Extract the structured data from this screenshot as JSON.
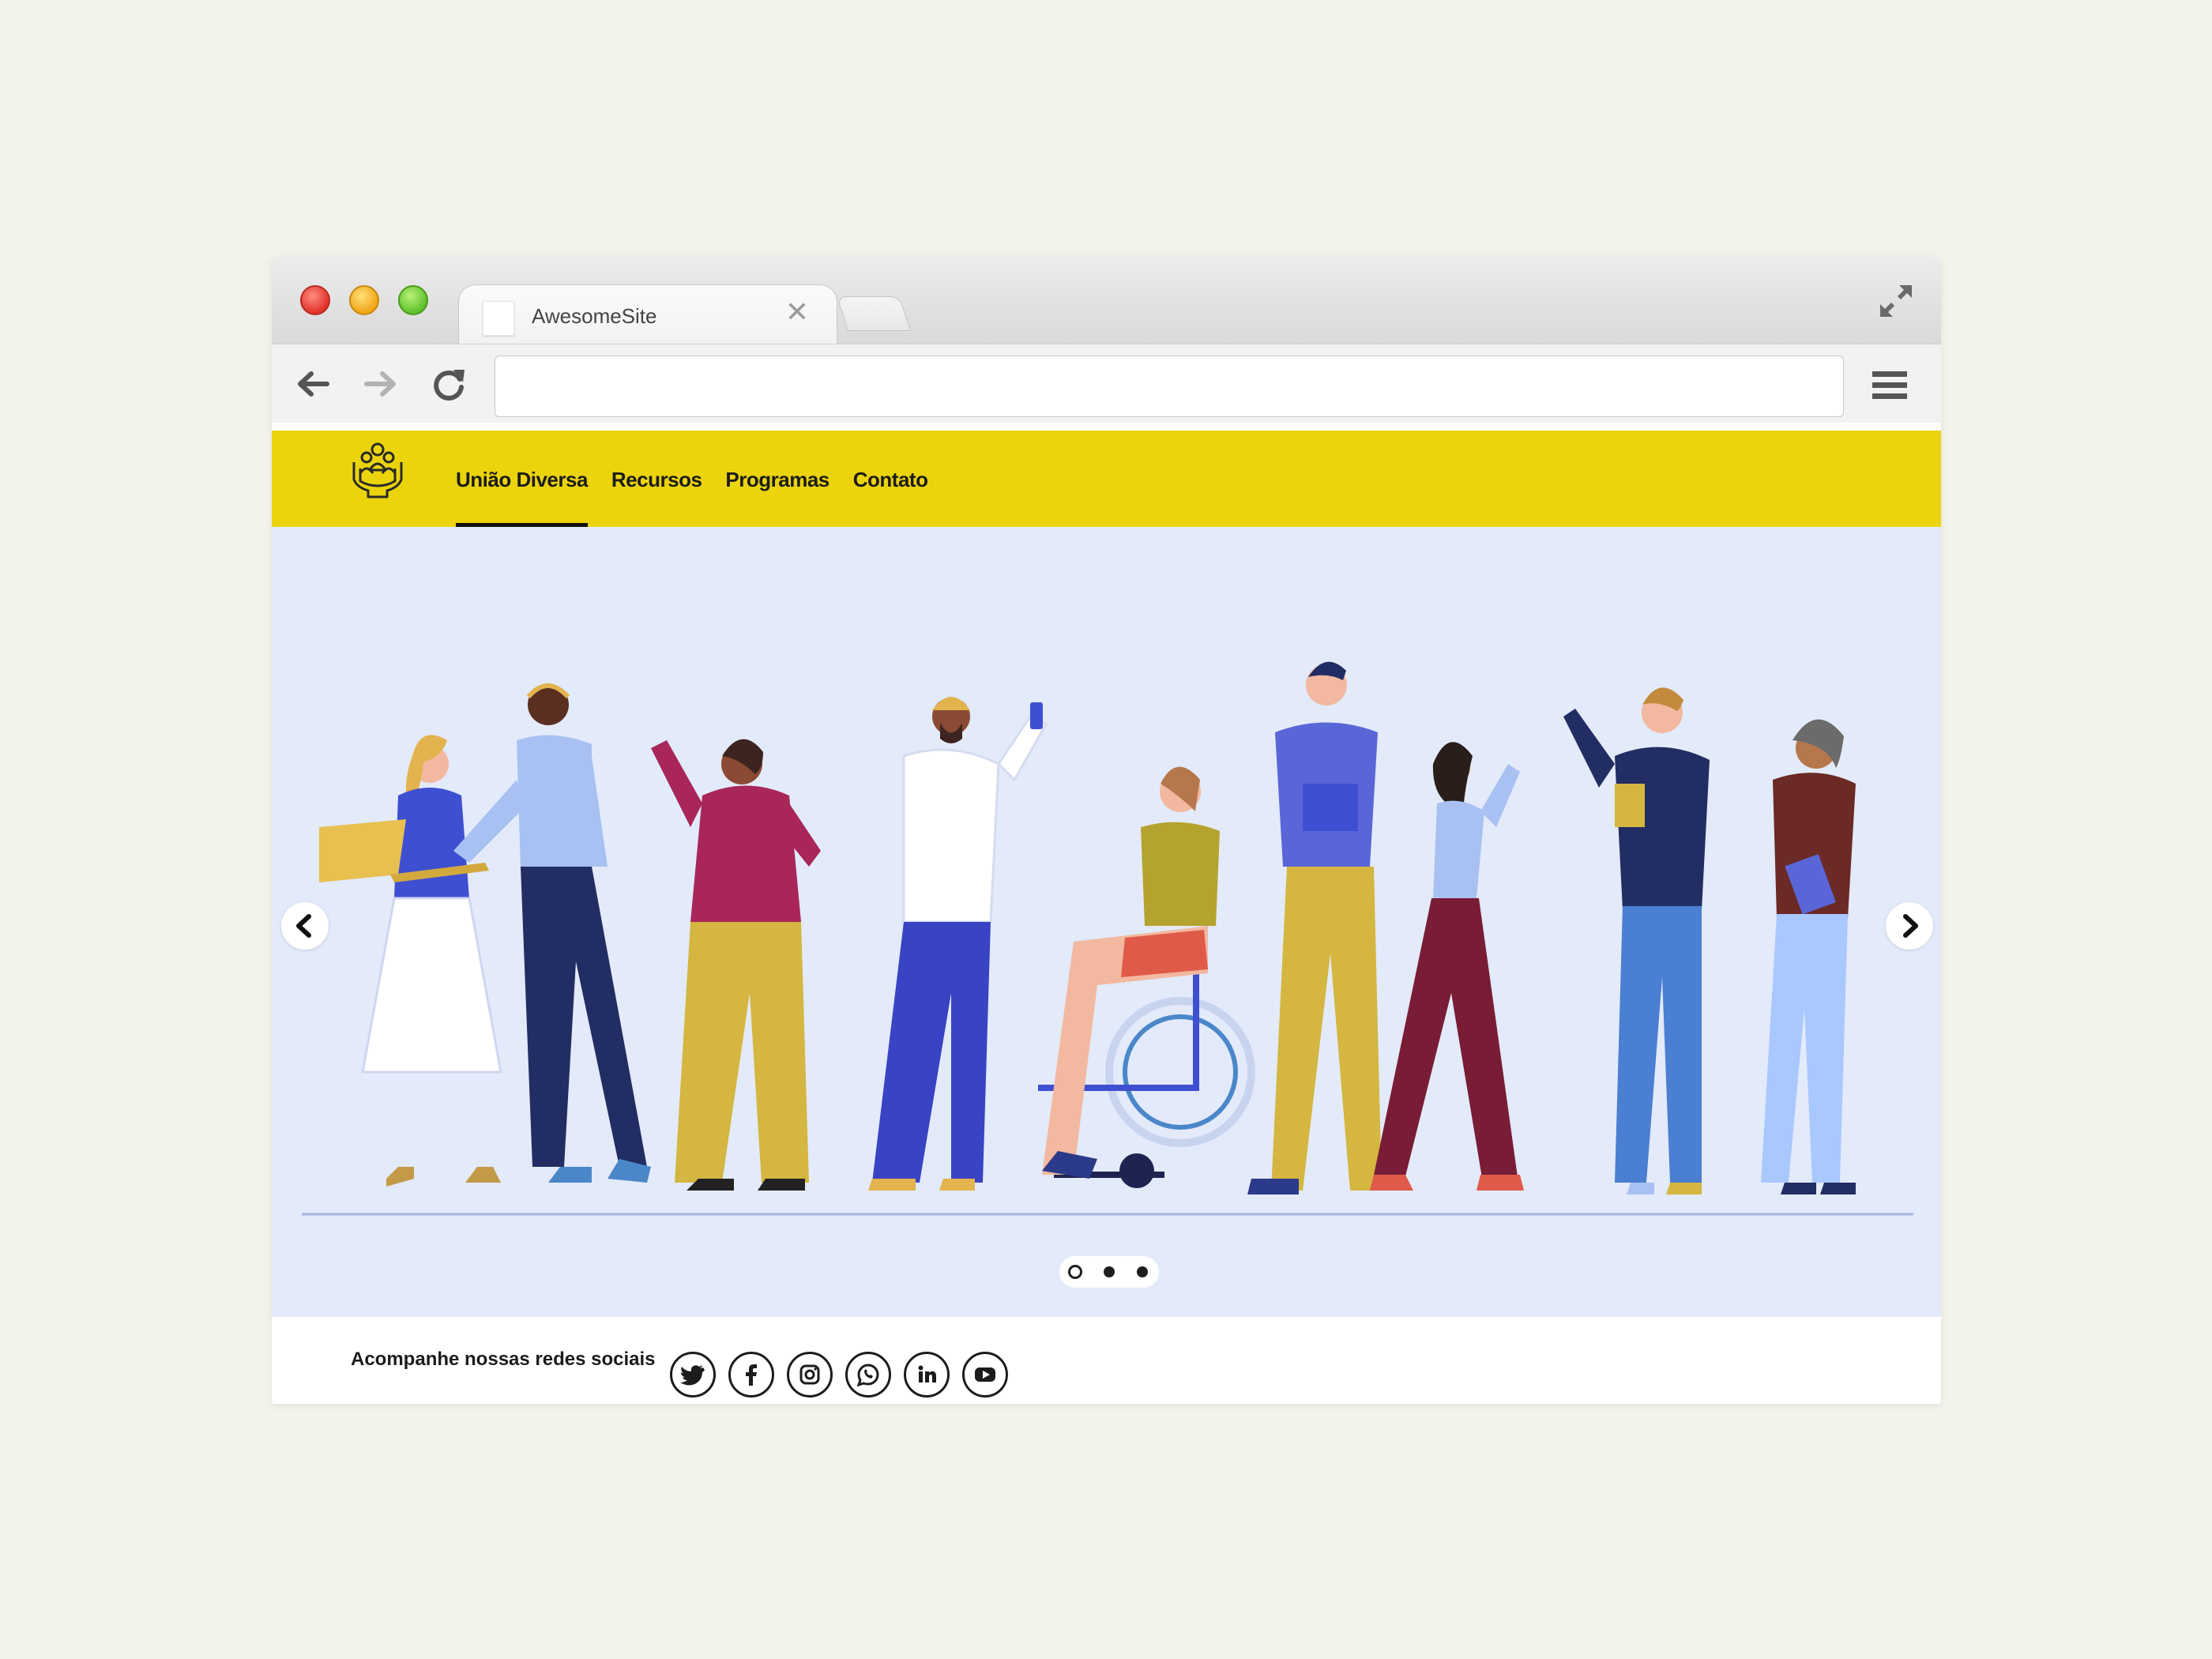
{
  "browser": {
    "tab_title": "AwesomeSite",
    "tab_close_glyph": "✕",
    "address_value": "",
    "icons": [
      "back-arrow-icon",
      "forward-arrow-icon",
      "reload-icon",
      "menu-icon",
      "fullscreen-icon"
    ]
  },
  "site": {
    "nav": [
      {
        "label": "União Diversa",
        "active": true
      },
      {
        "label": "Recursos",
        "active": false
      },
      {
        "label": "Programas",
        "active": false
      },
      {
        "label": "Contato",
        "active": false
      }
    ],
    "accent_color": "#ebd40c",
    "hero_bg": "#e3eaf9"
  },
  "carousel": {
    "current_slide": 1,
    "total_slides": 3
  },
  "footer": {
    "social_label": "Acompanhe nossas redes sociais",
    "social_icons": [
      "twitter-icon",
      "facebook-icon",
      "instagram-icon",
      "whatsapp-icon",
      "linkedin-icon",
      "youtube-icon"
    ]
  }
}
